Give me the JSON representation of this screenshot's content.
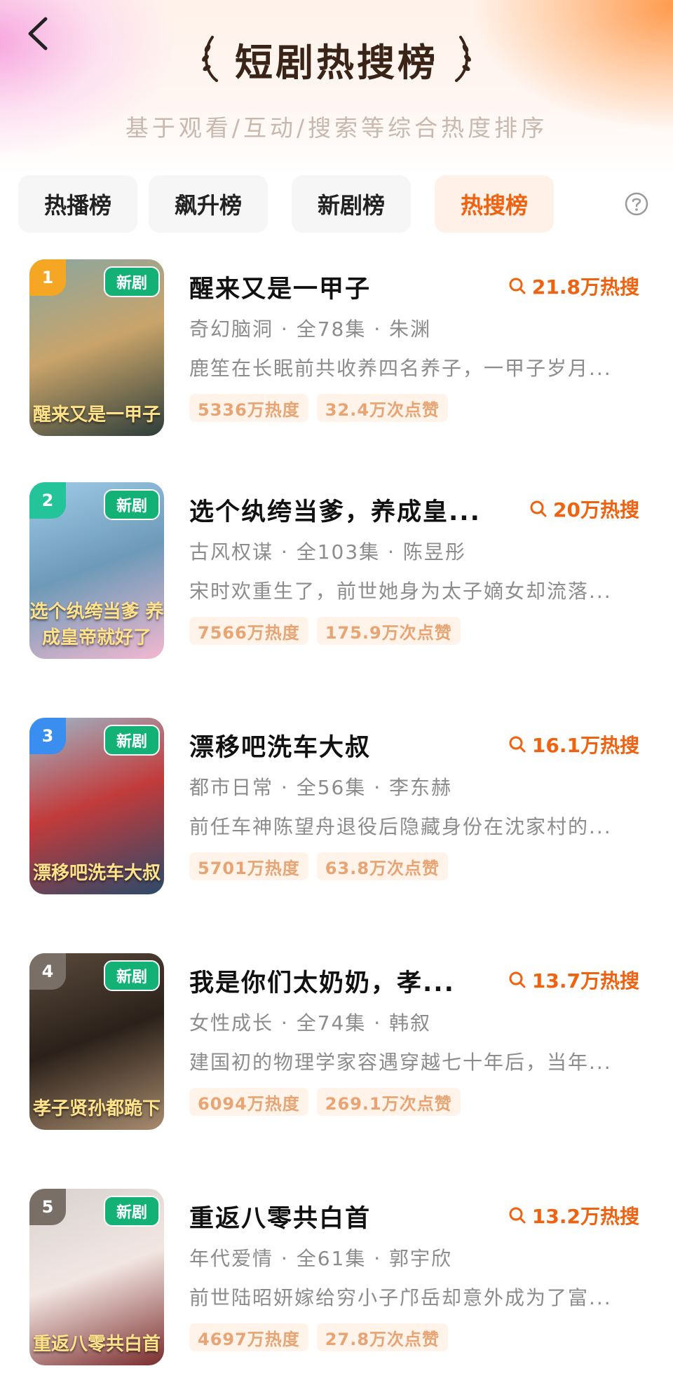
{
  "header": {
    "title": "短剧热搜榜",
    "subtitle": "基于观看/互动/搜索等综合热度排序"
  },
  "tabs": [
    {
      "label": "热播榜",
      "active": false
    },
    {
      "label": "飙升榜",
      "active": false
    },
    {
      "label": "新剧榜",
      "active": false
    },
    {
      "label": "热搜榜",
      "active": true
    }
  ],
  "colors": {
    "accent": "#f0620f",
    "new_badge": "#14b177",
    "stat_text": "#e8a473"
  },
  "items": [
    {
      "rank": "1",
      "rank_color": "#f5a623",
      "badge": "新剧",
      "poster_text": "醒来又是一甲子",
      "poster_colors": [
        "#8aa6a0",
        "#2d3d3a",
        "#c9a46a"
      ],
      "title": "醒来又是一甲子",
      "hot": "21.8万热搜",
      "meta": "奇幻脑洞 · 全78集 · 朱渊",
      "desc": "鹿笙在长眠前共收养四名养子，一甲子岁月...",
      "heat": "5336万热度",
      "likes": "32.4万次点赞"
    },
    {
      "rank": "2",
      "rank_color": "#23c49a",
      "badge": "新剧",
      "poster_text": "选个纨绔当爹 养成皇帝就好了",
      "poster_colors": [
        "#9ecbe8",
        "#f3b8d0",
        "#6d9ab8"
      ],
      "title": "选个纨绔当爹，养成皇...",
      "hot": "20万热搜",
      "meta": "古风权谋 · 全103集 · 陈昱彤",
      "desc": "宋时欢重生了，前世她身为太子嫡女却流落...",
      "heat": "7566万热度",
      "likes": "175.9万次点赞"
    },
    {
      "rank": "3",
      "rank_color": "#3a8ef0",
      "badge": "新剧",
      "poster_text": "漂移吧洗车大叔",
      "poster_colors": [
        "#9fb6c8",
        "#2b4a6a",
        "#c23b3b"
      ],
      "title": "漂移吧洗车大叔",
      "hot": "16.1万热搜",
      "meta": "都市日常 · 全56集 · 李东赫",
      "desc": "前任车神陈望舟退役后隐藏身份在沈家村的...",
      "heat": "5701万热度",
      "likes": "63.8万次点赞"
    },
    {
      "rank": "4",
      "rank_color": "#7a6f66",
      "badge": "新剧",
      "poster_text": "孝子贤孙都跪下",
      "poster_colors": [
        "#5a4a3c",
        "#a88b6e",
        "#2b211a"
      ],
      "title": "我是你们太奶奶，孝...",
      "hot": "13.7万热搜",
      "meta": "女性成长 · 全74集 · 韩叙",
      "desc": "建国初的物理学家容遇穿越七十年后，当年...",
      "heat": "6094万热度",
      "likes": "269.1万次点赞"
    },
    {
      "rank": "5",
      "rank_color": "#7a6f66",
      "badge": "新剧",
      "poster_text": "重返八零共白首",
      "poster_colors": [
        "#d7d2d0",
        "#7a2c2c",
        "#f2e6e2"
      ],
      "title": "重返八零共白首",
      "hot": "13.2万热搜",
      "meta": "年代爱情 · 全61集 · 郭宇欣",
      "desc": "前世陆昭妍嫁给穷小子邝岳却意外成为了富...",
      "heat": "4697万热度",
      "likes": "27.8万次点赞"
    }
  ]
}
